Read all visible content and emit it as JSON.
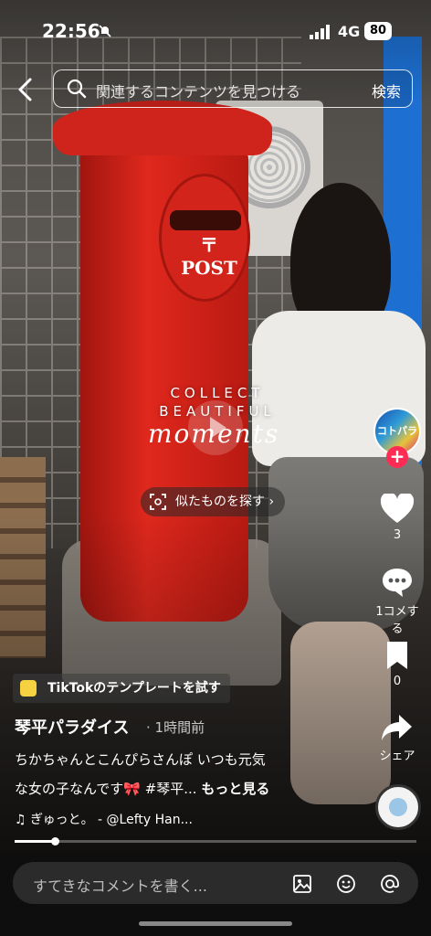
{
  "status_bar": {
    "time": "22:56",
    "network": "4G",
    "battery": "80"
  },
  "search": {
    "placeholder": "関連するコンテンツを見つける",
    "button_label": "検索"
  },
  "video_overlay": {
    "line1": "COLLECT",
    "line2": "BEAUTIFUL",
    "line3": "moments"
  },
  "similar_button": {
    "label": "似たものを探す"
  },
  "creator_avatar_text": "コトパラ",
  "actions": {
    "likes": "3",
    "comments": "1コメする",
    "saves": "0",
    "share": "シェア"
  },
  "template_chip": {
    "label": "TikTokのテンプレートを試す"
  },
  "post": {
    "author": "琴平パラダイス",
    "posted": "· 1時間前",
    "caption_line1": "ちかちゃんとこんぴらさんぽ いつも元気",
    "caption_line2": "な女の子なんです🎀 #琴平...",
    "more": "もっと見る",
    "music": "♫ ぎゅっと。 - @Lefty Han..."
  },
  "playback": {
    "progress_fraction": 0.1
  },
  "comment_bar": {
    "placeholder": "すてきなコメントを書く..."
  },
  "colors": {
    "accent": "#fe2c55",
    "postbox_red": "#d2241a",
    "pillar_blue": "#1d6fd1"
  }
}
